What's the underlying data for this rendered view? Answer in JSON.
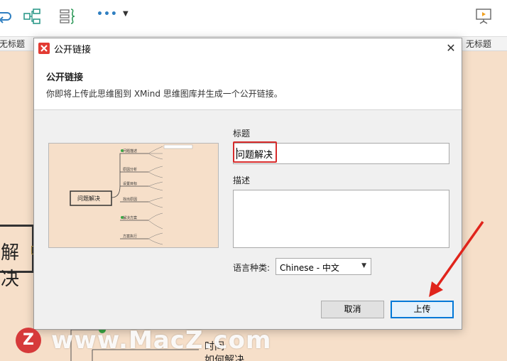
{
  "background": {
    "toolbar_icons": [
      "redo-icon",
      "mindmap-layout-icon",
      "outline-icon",
      "more-icon",
      "dropdown-icon",
      "presentation-icon"
    ],
    "more_dots": "•••",
    "doc_tab_left": "无标题",
    "doc_tab_right": "无标题",
    "central_topic_fragment": "解决",
    "bottom_texts": [
      "时间",
      "如何解决"
    ],
    "watermark": {
      "badge": "Z",
      "text": "www.MacZ.com"
    }
  },
  "dialog": {
    "window_title": "公开链接",
    "close_glyph": "✕",
    "header_title": "公开链接",
    "header_desc": "你即将上传此思维图到 XMind 思维图库并生成一个公开链接。",
    "preview": {
      "central": "问题解决",
      "branches": [
        "问题描述",
        "原因分析",
        "设置目标",
        "找出原因",
        "解决方案",
        "方案执行"
      ]
    },
    "title_label": "标题",
    "title_value": "问题解决",
    "desc_label": "描述",
    "desc_value": "",
    "language_label": "语言种类:",
    "language_value": "Chinese - 中文",
    "cancel_label": "取消",
    "upload_label": "上传"
  },
  "colors": {
    "canvas": "#f6dfc9",
    "highlight": "#d72b2b",
    "primary_border": "#0078d7",
    "app_icon": "#e23b33"
  }
}
